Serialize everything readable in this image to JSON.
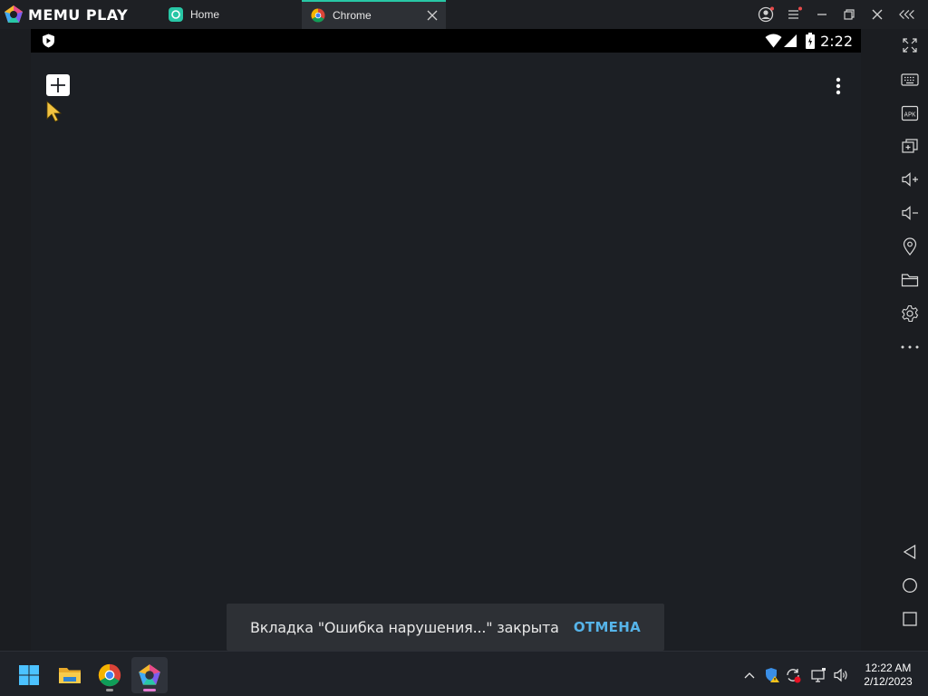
{
  "app": {
    "brand": "MEMU PLAY",
    "accent": "#28c7a6"
  },
  "tabs": [
    {
      "label": "Home",
      "icon": "memu-home-icon"
    },
    {
      "label": "Chrome",
      "icon": "chrome-icon",
      "active": true
    }
  ],
  "android": {
    "clock": "2:22",
    "snackbar": {
      "message": "Вкладка \"Ошибка нарушения...\" закрыта",
      "action": "ОТМЕНА",
      "action_color": "#56b4e9"
    }
  },
  "right_toolbar": [
    "fullscreen-icon",
    "keyboard-icon",
    "apk-icon",
    "multi-window-icon",
    "volume-up-icon",
    "volume-down-icon",
    "location-icon",
    "folder-icon",
    "settings-icon",
    "more-icon",
    "back-icon",
    "home-circle-icon",
    "recents-icon"
  ],
  "taskbar": {
    "apps": [
      "windows-start-icon",
      "file-explorer-icon",
      "chrome-icon",
      "memu-icon"
    ],
    "time": "12:22 AM",
    "date": "2/12/2023"
  }
}
